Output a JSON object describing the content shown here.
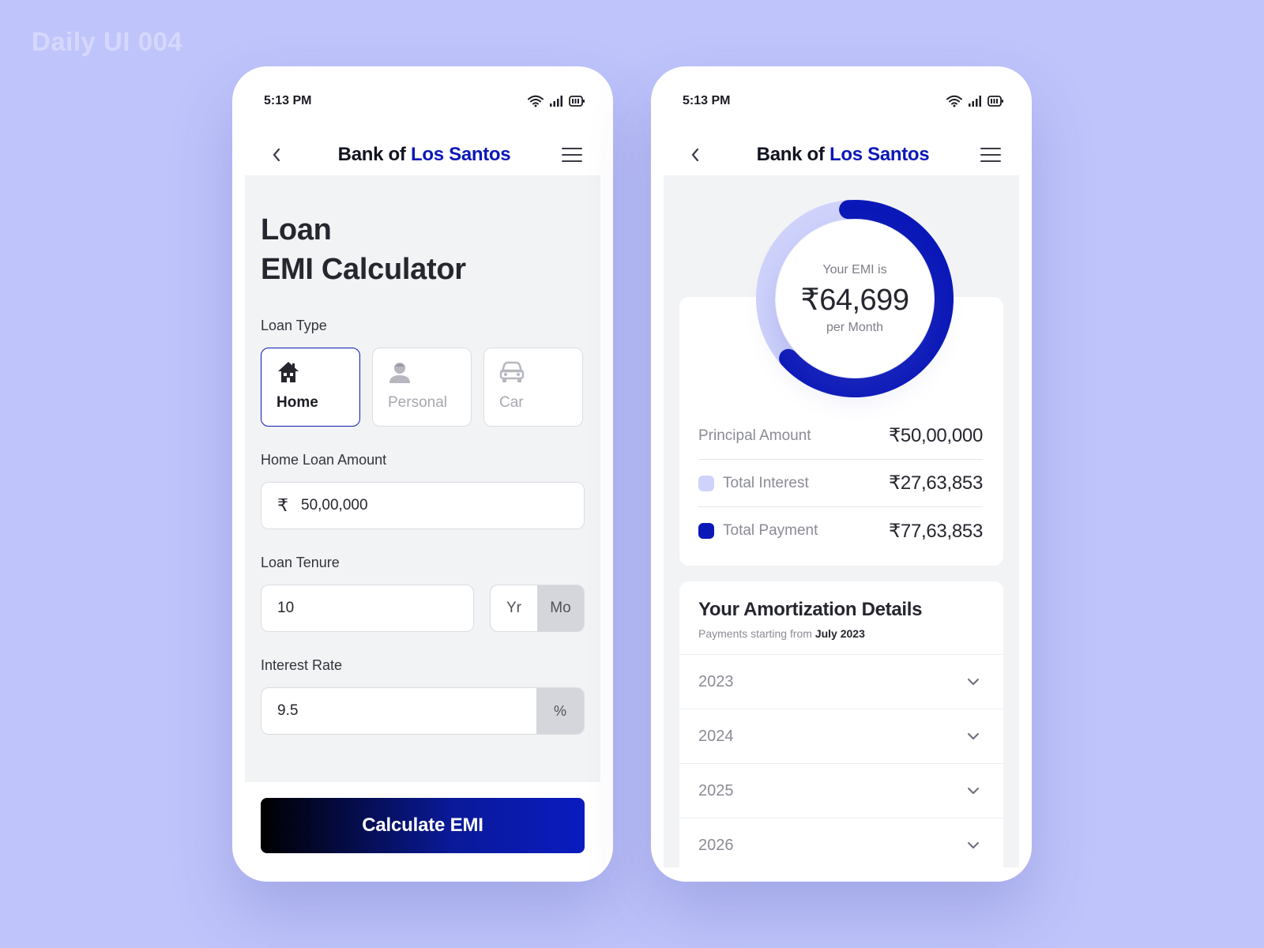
{
  "watermark": "Daily UI 004",
  "status_bar": {
    "time": "5:13 PM"
  },
  "brand": {
    "part1": "Bank of",
    "part2": "Los Santos"
  },
  "calculator": {
    "title_line1": "Loan",
    "title_line2": "EMI Calculator",
    "loan_type_label": "Loan Type",
    "loan_types": [
      {
        "label": "Home",
        "icon": "house-icon",
        "selected": true
      },
      {
        "label": "Personal",
        "icon": "person-icon",
        "selected": false
      },
      {
        "label": "Car",
        "icon": "car-icon",
        "selected": false
      }
    ],
    "amount_label": "Home Loan Amount",
    "currency_symbol": "₹",
    "amount_value": "50,00,000",
    "tenure_label": "Loan Tenure",
    "tenure_value": "10",
    "tenure_units": [
      "Yr",
      "Mo"
    ],
    "tenure_selected_unit": "Yr",
    "rate_label": "Interest Rate",
    "rate_value": "9.5",
    "rate_unit": "%",
    "cta_label": "Calculate EMI"
  },
  "result": {
    "emi_label": "Your EMI is",
    "emi_value": "₹64,699",
    "emi_period": "per Month",
    "principal_share": 0.644,
    "rows": [
      {
        "label": "Principal Amount",
        "value": "₹50,00,000"
      },
      {
        "label": "Total Interest",
        "value": "₹27,63,853"
      },
      {
        "label": "Total Payment",
        "value": "₹77,63,853"
      }
    ],
    "amortization": {
      "title": "Your Amortization Details",
      "subtitle_prefix": "Payments starting from",
      "start": "July 2023",
      "years": [
        "2023",
        "2024",
        "2025",
        "2026"
      ]
    }
  },
  "colors": {
    "accent": "#0b18b8",
    "interest_swatch": "#cfd3fb",
    "payment_swatch": "#0b18b8",
    "background": "#bfc4fb"
  }
}
